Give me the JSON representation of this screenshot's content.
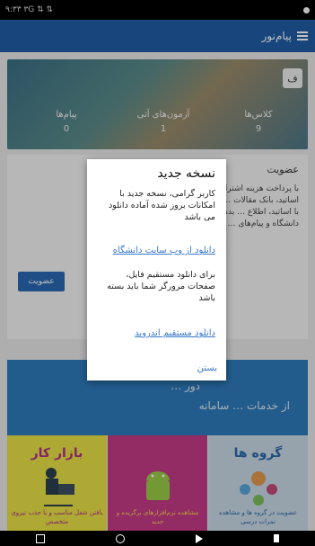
{
  "status": {
    "left_text": "۹:۳۳ ۳G ⇅ ⇅",
    "right_dot": ""
  },
  "appbar": {
    "title": "پیام‌نور"
  },
  "hero": {
    "badge": "ف",
    "stats": [
      {
        "label": "پیام‌ها",
        "value": "0"
      },
      {
        "label": "آزمون‌های آتی",
        "value": "1"
      },
      {
        "label": "کلاس‌ها",
        "value": "9"
      }
    ]
  },
  "membership": {
    "title": "عضویت",
    "body_lines": [
      "با پرداخت هزینه اشتراک … ده نمرات، ارتباط با",
      "اساتید، بانک مقالات … سامانه های ارتباط",
      "با اساتید، اطلاع … بدهی مالی، اخبار",
      "دانشگاه و پیام‌های … داشت."
    ],
    "button": "عضویت"
  },
  "banner": {
    "line1": "از خدمات … سامانه",
    "line2": "… دور"
  },
  "tiles": [
    {
      "title": "بازار کار",
      "caption": "یافتن شغل مناسب و یا جذب نیروی متخصص",
      "bg": "#e8e046",
      "fg": "#b0318b"
    },
    {
      "title": "",
      "caption": "مشاهده نرم‌افزارهای برگزیده و جدید",
      "bg": "#c43a86",
      "fg": "#f6d84c"
    },
    {
      "title": "گروه ها",
      "caption": "عضویت در گروه ها و مشاهده نمرات درسی",
      "bg": "#c8d8e6",
      "fg": "#2b69a8"
    }
  ],
  "dialog": {
    "title": "نسخه جدید",
    "message": "کاربر گرامی، نسخه جدید با امکانات بروز شده آماده دانلود می باشد",
    "link1": "دانلود از وب سایت دانشگاه",
    "message2": "برای دانلود مستقیم فایل، صفحات مرورگر شما باید بسته باشد",
    "link2": "دانلود مستقیم اندروید",
    "close": "بستن"
  }
}
